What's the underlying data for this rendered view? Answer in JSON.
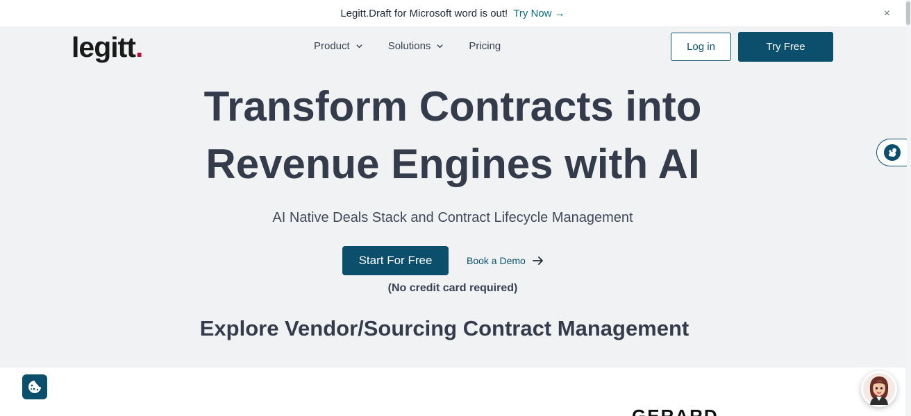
{
  "announcement": {
    "message": "Legitt.Draft for Microsoft word is out!",
    "cta": "Try Now →",
    "close": "×"
  },
  "nav": {
    "logo_text": "legitt",
    "logo_dot": ".",
    "items": [
      {
        "label": "Product",
        "has_dropdown": true
      },
      {
        "label": "Solutions",
        "has_dropdown": true
      },
      {
        "label": "Pricing",
        "has_dropdown": false
      }
    ],
    "login_label": "Log in",
    "try_free_label": "Try Free"
  },
  "hero": {
    "title_line1": "Transform Contracts into",
    "title_line2": "Revenue Engines with AI",
    "subtitle": "AI Native Deals Stack and Contract Lifecycle Management",
    "start_label": "Start For Free",
    "demo_label": "Book a Demo",
    "note": "(No credit card required)",
    "explore": "Explore Vendor/Sourcing Contract Management"
  },
  "partial_logo_text": "GERARD",
  "colors": {
    "brand": "#0b4f6c",
    "accent_dot": "#b3123f",
    "link": "#0f6b7a",
    "heading": "#343c4b",
    "background": "#f1f2f4"
  },
  "icons": {
    "dropdown": "chevron-down-icon",
    "demo_arrow": "arrow-right-icon",
    "cookie": "cookie-icon",
    "side_widget": "squirrel-icon",
    "chat": "assistant-avatar-icon",
    "close": "close-icon"
  }
}
